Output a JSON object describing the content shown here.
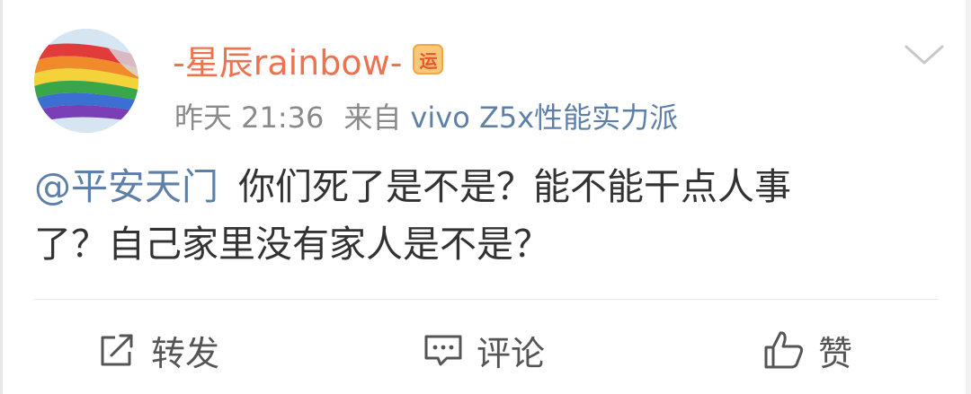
{
  "post": {
    "username": "-星辰rainbow-",
    "badge_char": "运",
    "time": "昨天 21:36",
    "from_label": "来自",
    "source": "vivo Z5x性能实力派",
    "mention": "@平安天门",
    "content_line1_rest": "你们死了是不是？能不能干点人事",
    "content_line2": "了？自己家里没有家人是不是？"
  },
  "actions": {
    "repost_label": "转发",
    "comment_label": "评论",
    "like_label": "赞"
  },
  "icons": {
    "avatar": "rainbow-flag-avatar",
    "badge": "yun-badge-icon",
    "chevron": "chevron-down-icon",
    "repost": "repost-icon",
    "comment": "comment-icon",
    "like": "thumbs-up-icon"
  },
  "colors": {
    "username": "#eb7350",
    "link": "#5d7fa8",
    "meta": "#8a8a8a",
    "text": "#333333"
  }
}
